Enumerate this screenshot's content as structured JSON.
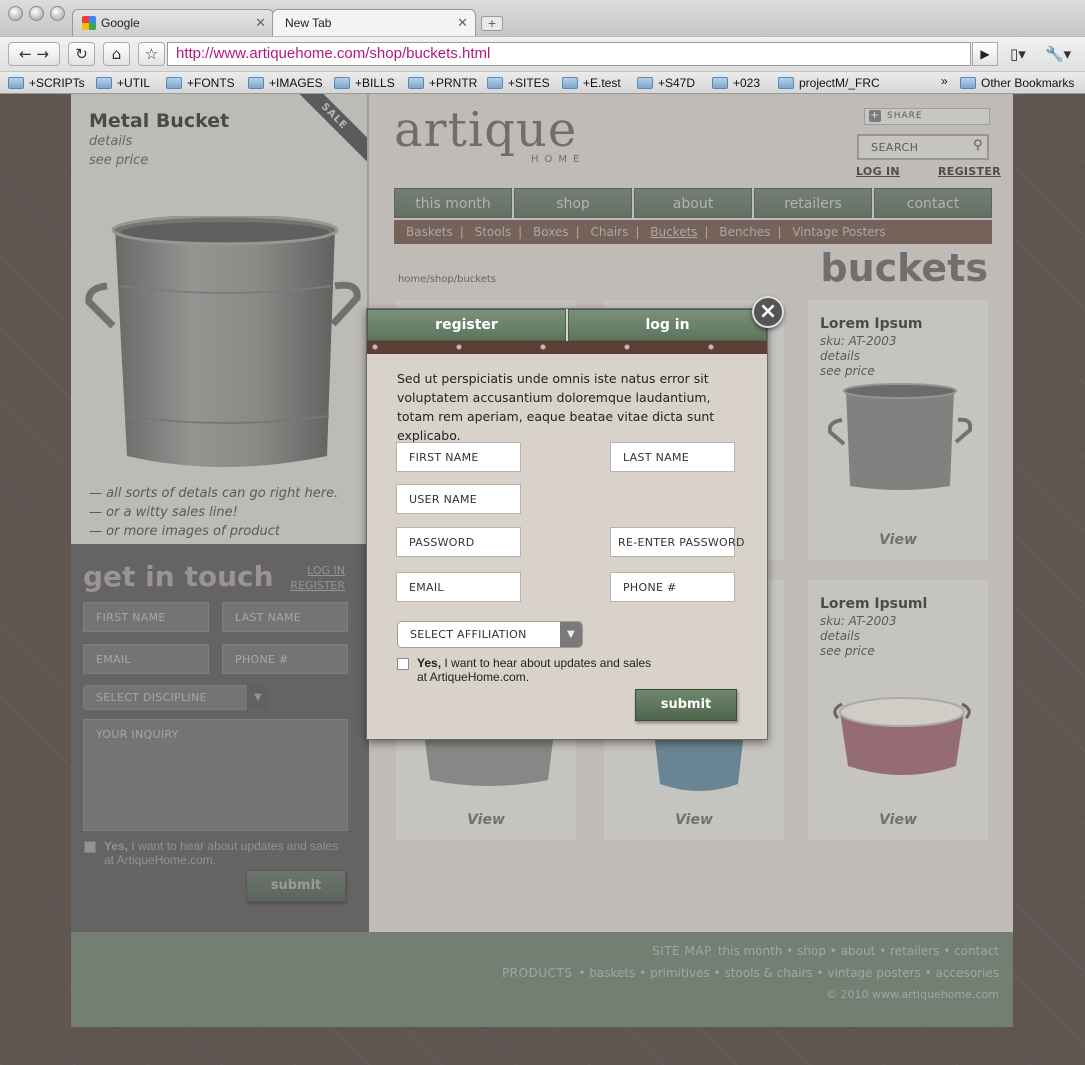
{
  "browser": {
    "tabs": [
      {
        "label": "Google"
      },
      {
        "label": "New Tab"
      }
    ],
    "url": "http://www.artiquehome.com/shop/buckets.html",
    "bookmarks": [
      "+SCRIPTs",
      "+UTIL",
      "+FONTS",
      "+IMAGES",
      "+BILLS",
      "+PRNTR",
      "+SITES",
      "+E.test",
      "+S47D",
      "+023",
      "projectM/_FRC"
    ],
    "overflow": "»",
    "other_bookmarks": "Other Bookmarks"
  },
  "left": {
    "product_name": "Metal Bucket",
    "details": "details",
    "see_price": "see price",
    "ribbon": "SALE",
    "taglines": [
      "— all sorts of detals can go right here.",
      "— or a witty sales line!",
      "— or more images of product"
    ]
  },
  "contact": {
    "title": "get in touch",
    "login": "LOG IN",
    "register": "REGISTER",
    "first_name": "FIRST NAME",
    "last_name": "LAST NAME",
    "email": "EMAIL",
    "phone": "PHONE #",
    "discipline": "SELECT DISCIPLINE",
    "inquiry": "YOUR INQUIRY",
    "yes": "Yes,",
    "optin": " I want to hear about updates and sales",
    "optin2": "at ArtiqueHome.com.",
    "submit": "submit"
  },
  "header": {
    "logo": "artique",
    "logo_sub": "HOME",
    "share": "SHARE",
    "search": "SEARCH",
    "login": "LOG IN",
    "register": "REGISTER"
  },
  "nav": [
    "this month",
    "shop",
    "about",
    "retailers",
    "contact"
  ],
  "subnav": [
    "Baskets",
    "Stools",
    "Boxes",
    "Chairs",
    "Buckets",
    "Benches",
    "Vintage Posters"
  ],
  "breadcrumb": "home/shop/buckets",
  "page_title": "buckets",
  "cards": {
    "top_right": {
      "title": "Lorem Ipsum",
      "sku": "sku: AT-2003",
      "details": "details",
      "see_price": "see price",
      "view": "View"
    },
    "bottom_right": {
      "title": "Lorem Ipsuml",
      "sku": "sku: AT-2003",
      "details": "details",
      "see_price": "see price",
      "view": "View"
    },
    "bottom_left_view": "View",
    "bottom_mid_view": "View"
  },
  "footer": {
    "sitemap": "SITE MAP",
    "sitemap_links": "this month • shop • about • retailers • contact",
    "products": "PRODUCTS",
    "product_links": "• baskets • primitives • stools & chairs • vintage posters • accesories",
    "copyright": "© 2010 www.artiquehome.com"
  },
  "modal": {
    "tab_register": "register",
    "tab_login": "log in",
    "close": "×",
    "intro": "Sed ut perspiciatis unde omnis iste natus error sit voluptatem accusantium doloremque laudantium, totam rem aperiam, eaque beatae vitae dicta sunt explicabo.",
    "first_name": "FIRST NAME",
    "last_name": "LAST NAME",
    "user_name": "USER NAME",
    "password": "PASSWORD",
    "reenter": "RE-ENTER PASSWORD",
    "email": "EMAIL",
    "phone": "PHONE #",
    "affiliation": "SELECT AFFILIATION",
    "yes": "Yes,",
    "optin": " I want to hear about updates and sales",
    "optin2": "at ArtiqueHome.com.",
    "submit": "submit"
  },
  "colors": {
    "nav_green": "#4f5f4f",
    "subnav_brown": "#5b3f34",
    "url_magenta": "#b4197a",
    "modal_bg": "#d9d2cb"
  }
}
